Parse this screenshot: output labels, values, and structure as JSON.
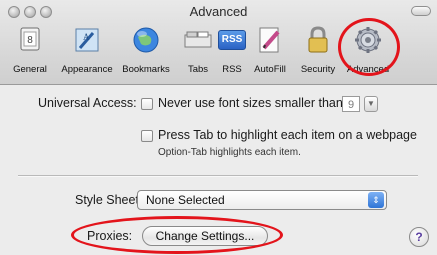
{
  "window": {
    "title": "Advanced"
  },
  "toolbar": {
    "items": [
      {
        "label": "General"
      },
      {
        "label": "Appearance"
      },
      {
        "label": "Bookmarks"
      },
      {
        "label": "Tabs"
      },
      {
        "label": "RSS",
        "icon_text": "RSS"
      },
      {
        "label": "AutoFill"
      },
      {
        "label": "Security"
      },
      {
        "label": "Advanced",
        "selected": true
      }
    ]
  },
  "universal_access": {
    "label": "Universal Access:",
    "font_size_option": "Never use font sizes smaller than",
    "font_size_value": "9",
    "tab_option": "Press Tab to highlight each item on a webpage",
    "tab_note": "Option-Tab highlights each item."
  },
  "style_sheet": {
    "label": "Style Sheet:",
    "value": "None Selected"
  },
  "proxies": {
    "label": "Proxies:",
    "button": "Change Settings..."
  },
  "help": {
    "glyph": "?"
  },
  "colors": {
    "annotation_red": "#e3141b",
    "popup_blue": "#2f74d6"
  }
}
